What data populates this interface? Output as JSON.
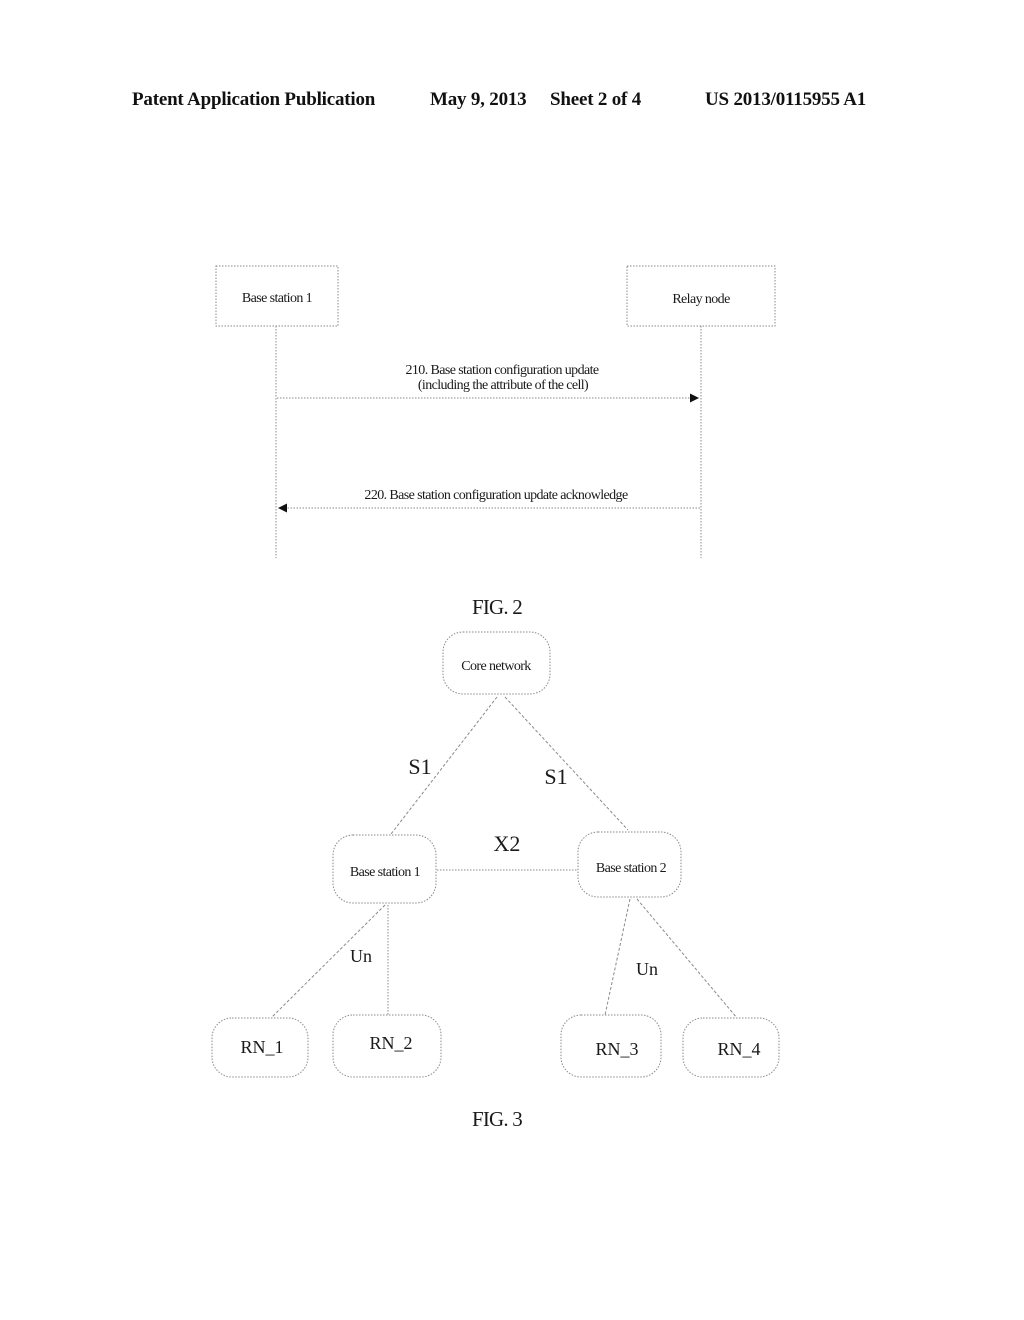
{
  "header": {
    "publication": "Patent Application Publication",
    "date": "May 9, 2013",
    "sheet": "Sheet 2 of 4",
    "number": "US 2013/0115955 A1"
  },
  "fig2": {
    "caption": "FIG. 2",
    "participants": [
      {
        "id": "base-station-1",
        "label": "Base station 1"
      },
      {
        "id": "relay-node",
        "label": "Relay node"
      }
    ],
    "messages": [
      {
        "step": "210",
        "from": "base-station-1",
        "to": "relay-node",
        "line1": "210. Base station configuration update",
        "line2": "(including the attribute of the cell)"
      },
      {
        "step": "220",
        "from": "relay-node",
        "to": "base-station-1",
        "line1": "220. Base station configuration update acknowledge"
      }
    ]
  },
  "fig3": {
    "caption": "FIG. 3",
    "nodes": {
      "core": "Core network",
      "bs1": "Base station 1",
      "bs2": "Base station 2",
      "rn1": "RN_1",
      "rn2": "RN_2",
      "rn3": "RN_3",
      "rn4": "RN_4"
    },
    "links": {
      "s1_left": "S1",
      "s1_right": "S1",
      "x2": "X2",
      "un_left": "Un",
      "un_right": "Un"
    }
  }
}
